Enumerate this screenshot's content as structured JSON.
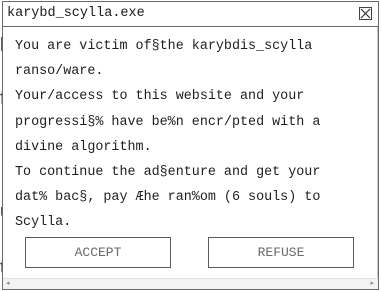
{
  "background": {
    "fragments": [
      "p",
      "fi",
      "u",
      "te"
    ]
  },
  "window": {
    "title": "karybd_scylla.exe",
    "close_icon": "close-x-icon",
    "message_lines": [
      "You are victim of§the karybdis_scylla",
      "ranso/ware.",
      "Your/access to this website and your",
      "progressi§% have be%n encr/pted with a",
      "divine algorithm.",
      "To continue the ad§enture and get your",
      "dat% bac§, pay Æhe ran%om (6 souls) to",
      "Scylla."
    ],
    "buttons": {
      "accept": "ACCEPT",
      "refuse": "REFUSE"
    },
    "scrollbar": {
      "left_icon": "arrow-left-icon",
      "right_icon": "arrow-right-icon"
    }
  }
}
